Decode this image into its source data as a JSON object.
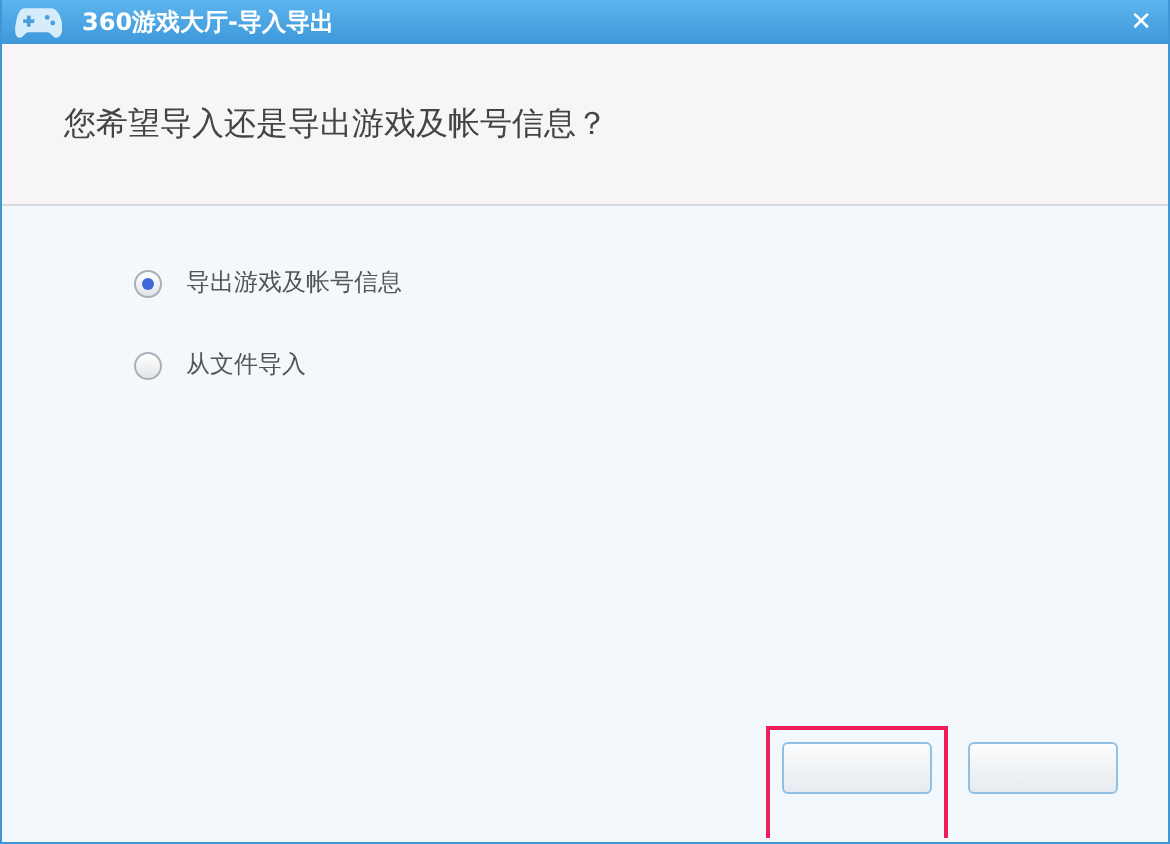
{
  "window": {
    "title": "360游戏大厅-导入导出",
    "close": "✕"
  },
  "question": "您希望导入还是导出游戏及帐号信息？",
  "options": [
    {
      "label": "导出游戏及帐号信息",
      "selected": true
    },
    {
      "label": "从文件导入",
      "selected": false
    }
  ],
  "buttons": [
    {
      "highlighted": true
    },
    {
      "highlighted": false
    }
  ]
}
